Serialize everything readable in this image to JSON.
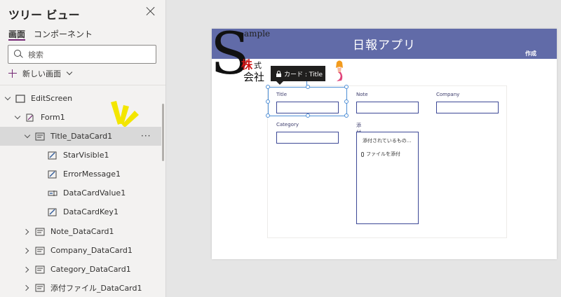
{
  "panel": {
    "title": "ツリー ビュー",
    "tabs": [
      {
        "label": "画面",
        "active": true
      },
      {
        "label": "コンポーネント",
        "active": false
      }
    ],
    "search_placeholder": "検索",
    "new_screen_label": "新しい画面",
    "tree": [
      {
        "label": "EditScreen",
        "icon": "screen-icon",
        "chevron": "down"
      },
      {
        "label": "Form1",
        "icon": "form-edit-icon",
        "chevron": "down"
      },
      {
        "label": "Title_DataCard1",
        "icon": "datacard-icon",
        "chevron": "down",
        "selected": true
      },
      {
        "label": "StarVisible1",
        "icon": "edit-control-icon",
        "chevron": "none"
      },
      {
        "label": "ErrorMessage1",
        "icon": "edit-control-icon",
        "chevron": "none"
      },
      {
        "label": "DataCardValue1",
        "icon": "text-input-icon",
        "chevron": "none"
      },
      {
        "label": "DataCardKey1",
        "icon": "edit-control-icon",
        "chevron": "none"
      },
      {
        "label": "Note_DataCard1",
        "icon": "datacard-icon",
        "chevron": "right"
      },
      {
        "label": "Company_DataCard1",
        "icon": "datacard-icon",
        "chevron": "right"
      },
      {
        "label": "Category_DataCard1",
        "icon": "datacard-icon",
        "chevron": "right"
      },
      {
        "label": "添付ファイル_DataCard1",
        "icon": "datacard-icon",
        "chevron": "right"
      }
    ],
    "more_label": "···"
  },
  "canvas": {
    "header_color": "#616ba8",
    "app_title": "日報アプリ",
    "create_label": "作成",
    "logo": {
      "sample": "ample",
      "kabu": "株",
      "shiki": "式",
      "kaisha": "会社"
    },
    "tooltip": "カード : Title",
    "cards": {
      "title": "Title",
      "note": "Note",
      "company": "Company",
      "category": "Category",
      "attachments": "添付ファイル"
    },
    "attachments_placeholder": "添付されているもの...",
    "attach_button": "ファイルを添付"
  }
}
